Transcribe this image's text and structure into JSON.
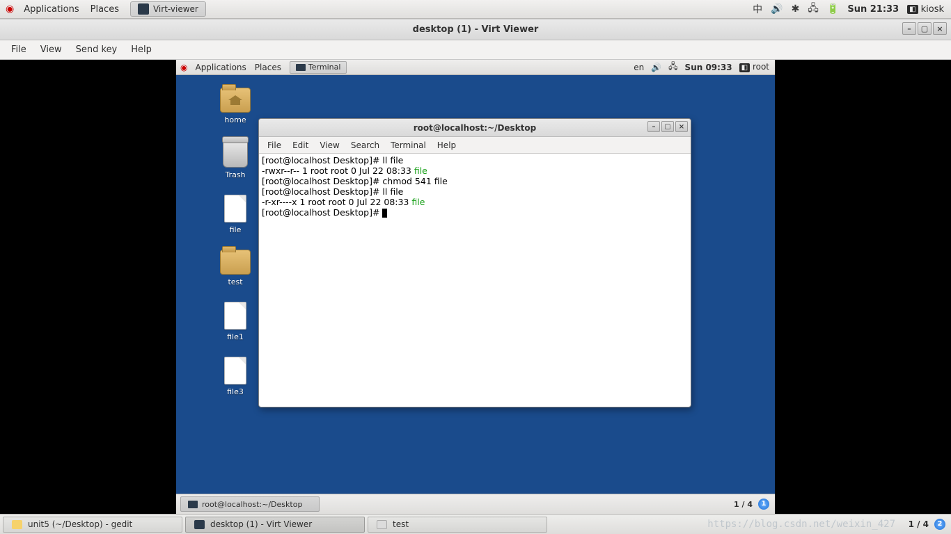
{
  "host_panel": {
    "menu_applications": "Applications",
    "menu_places": "Places",
    "viewer_tab": "Virt-viewer",
    "lang_indicator": "中",
    "clock": "Sun 21:33",
    "user": "kiosk"
  },
  "virt_viewer": {
    "title": "desktop (1) - Virt Viewer",
    "menu": {
      "file": "File",
      "view": "View",
      "sendkey": "Send key",
      "help": "Help"
    }
  },
  "guest_panel": {
    "menu_applications": "Applications",
    "menu_places": "Places",
    "app_tab": "Terminal",
    "lang": "en",
    "clock": "Sun 09:33",
    "user": "root"
  },
  "desktop_icons": {
    "home": "home",
    "trash": "Trash",
    "file": "file",
    "test": "test",
    "file1": "file1",
    "file3": "file3"
  },
  "terminal": {
    "title": "root@localhost:~/Desktop",
    "menu": {
      "file": "File",
      "edit": "Edit",
      "view": "View",
      "search": "Search",
      "terminal": "Terminal",
      "help": "Help"
    },
    "lines": {
      "l1_prompt": "[root@localhost Desktop]# ll file",
      "l2_perm": "-rwxr--r-- 1 root root 0 Jul 22 08:33 ",
      "l2_name": "file",
      "l3_prompt": "[root@localhost Desktop]# chmod 541 file",
      "l4_prompt": "[root@localhost Desktop]# ll file",
      "l5_perm": "-r-xr----x 1 root root 0 Jul 22 08:33 ",
      "l5_name": "file",
      "l6_prompt": "[root@localhost Desktop]# "
    }
  },
  "guest_taskbar": {
    "task1": "root@localhost:~/Desktop",
    "pager": "1 / 4",
    "workspace": "1"
  },
  "host_taskbar": {
    "task1": "unit5 (~/Desktop) - gedit",
    "task2": "desktop (1) - Virt Viewer",
    "task3": "test",
    "pager": "1 / 4",
    "workspace": "2"
  },
  "watermark": "https://blog.csdn.net/weixin_427"
}
